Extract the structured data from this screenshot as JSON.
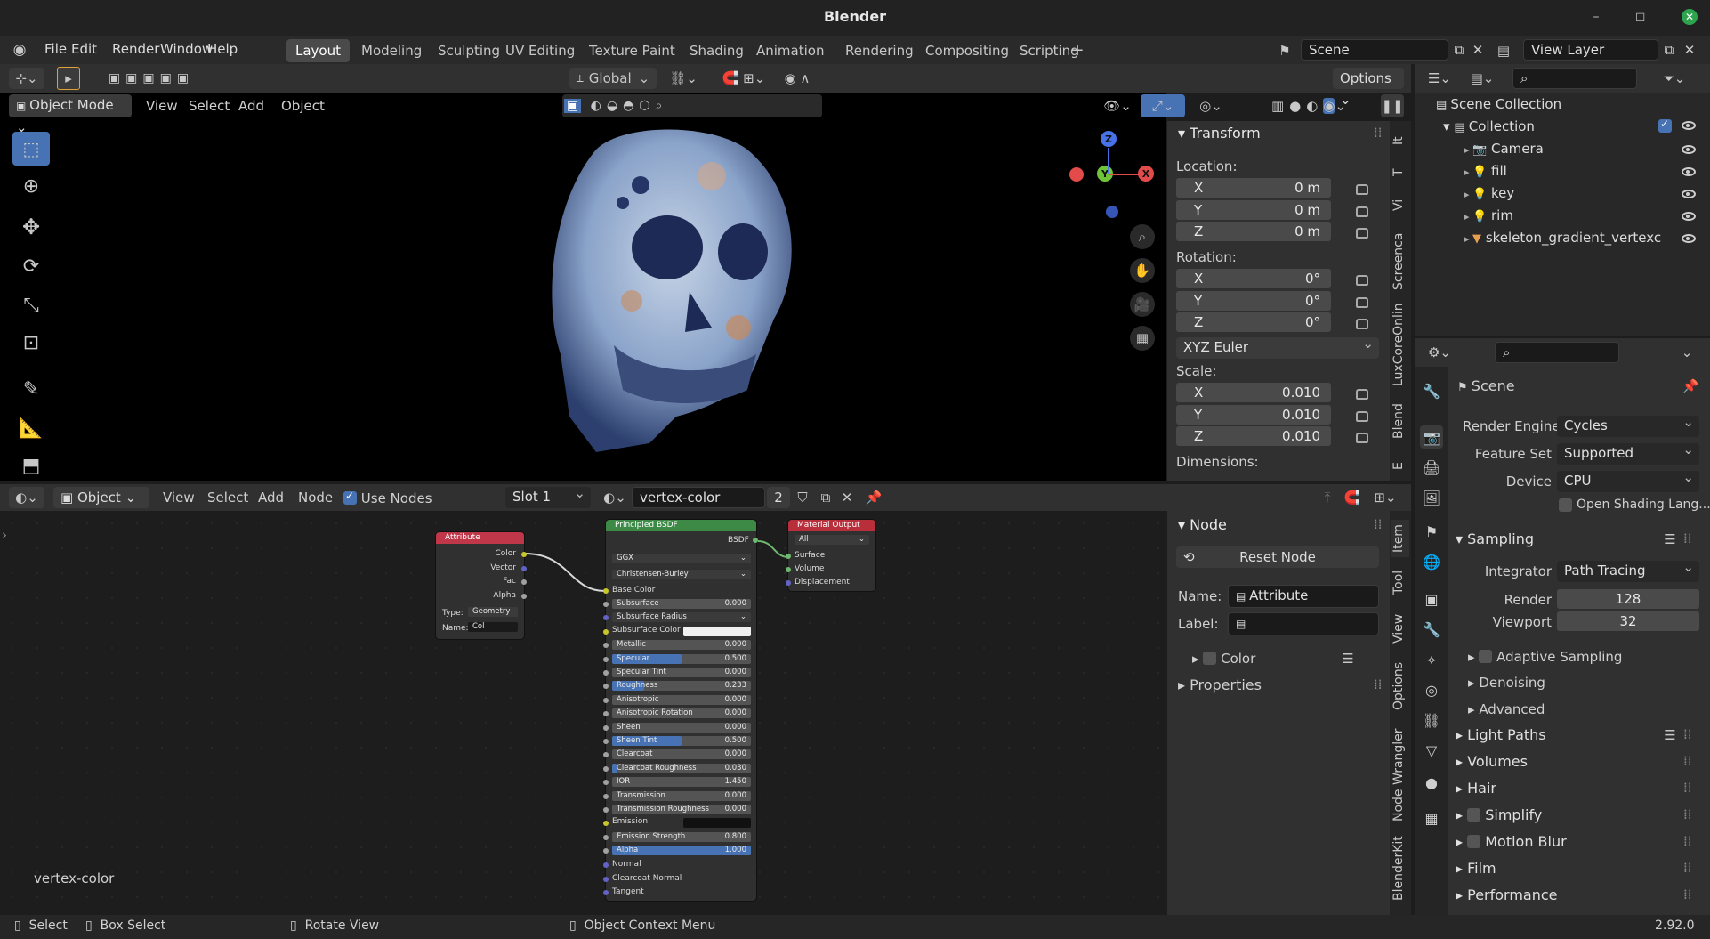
{
  "window": {
    "title": "Blender",
    "minimize": "–",
    "maximize": "◻",
    "close": "✕"
  },
  "menu": [
    "File",
    "Edit",
    "Render",
    "Window",
    "Help"
  ],
  "workspaces": [
    "Layout",
    "Modeling",
    "Sculpting",
    "UV Editing",
    "Texture Paint",
    "Shading",
    "Animation",
    "Rendering",
    "Compositing",
    "Scripting"
  ],
  "active_workspace": "Layout",
  "scene_name": "Scene",
  "view_layer": "View Layer",
  "viewport": {
    "mode": "Object Mode",
    "menus": [
      "View",
      "Select",
      "Add",
      "Object"
    ],
    "orientation": "Global",
    "options": "Options",
    "gizmo_axes": [
      "X",
      "Y",
      "Z"
    ]
  },
  "transform": {
    "title": "Transform",
    "location_label": "Location:",
    "rotation_label": "Rotation:",
    "scale_label": "Scale:",
    "dimensions_label": "Dimensions:",
    "location": [
      {
        "axis": "X",
        "value": "0 m"
      },
      {
        "axis": "Y",
        "value": "0 m"
      },
      {
        "axis": "Z",
        "value": "0 m"
      }
    ],
    "rotation": [
      {
        "axis": "X",
        "value": "0°"
      },
      {
        "axis": "Y",
        "value": "0°"
      },
      {
        "axis": "Z",
        "value": "0°"
      }
    ],
    "rotation_mode": "XYZ Euler",
    "scale": [
      {
        "axis": "X",
        "value": "0.010"
      },
      {
        "axis": "Y",
        "value": "0.010"
      },
      {
        "axis": "Z",
        "value": "0.010"
      }
    ]
  },
  "viewport_side_tabs": [
    "It",
    "T",
    "Vi",
    "Screenca",
    "LuxCoreOnlin",
    "Blend",
    "E"
  ],
  "outliner": {
    "root": "Scene Collection",
    "collection": "Collection",
    "items": [
      "Camera",
      "fill",
      "key",
      "rim",
      "skeleton_gradient_vertexc"
    ]
  },
  "properties": {
    "context": "Scene",
    "render_engine_label": "Render Engine",
    "render_engine": "Cycles",
    "feature_set_label": "Feature Set",
    "feature_set": "Supported",
    "device_label": "Device",
    "device": "CPU",
    "osl_label": "Open Shading Lang...",
    "sampling": "Sampling",
    "integrator_label": "Integrator",
    "integrator": "Path Tracing",
    "render_label": "Render",
    "render_samples": "128",
    "viewport_label": "Viewport",
    "viewport_samples": "32",
    "adaptive_sampling": "Adaptive Sampling",
    "denoising": "Denoising",
    "advanced": "Advanced",
    "sections": [
      "Light Paths",
      "Volumes",
      "Hair",
      "Simplify",
      "Motion Blur",
      "Film",
      "Performance"
    ]
  },
  "node_editor": {
    "object_dd": "Object",
    "menus": [
      "View",
      "Select",
      "Add",
      "Node"
    ],
    "use_nodes": "Use Nodes",
    "slot": "Slot 1",
    "material": "vertex-color",
    "users": "2",
    "tree_label": "vertex-color",
    "side_tabs": [
      "Item",
      "Tool",
      "View",
      "Options",
      "Node Wrangler",
      "BlenderKit"
    ]
  },
  "node_panel": {
    "title": "Node",
    "reset": "Reset Node",
    "name_label": "Name:",
    "name": "Attribute",
    "label_label": "Label:",
    "label": "",
    "color": "Color",
    "properties": "Properties"
  },
  "attribute_node": {
    "title": "Attribute",
    "outputs": [
      "Color",
      "Vector",
      "Fac",
      "Alpha"
    ],
    "type_label": "Type:",
    "type": "Geometry",
    "name_label": "Name:",
    "name": "Col"
  },
  "bsdf_node": {
    "title": "Principled BSDF",
    "output": "BSDF",
    "distribution": "GGX",
    "subsurface_method": "Christensen-Burley",
    "base_color": "Base Color",
    "rows": [
      {
        "label": "Subsurface",
        "value": "0.000",
        "fill": 0
      },
      {
        "label": "Subsurface Radius",
        "value": "",
        "fill": 0
      },
      {
        "label": "Subsurface Color",
        "value": "",
        "fill": 0
      },
      {
        "label": "Metallic",
        "value": "0.000",
        "fill": 0
      },
      {
        "label": "Specular",
        "value": "0.500",
        "fill": 0.5
      },
      {
        "label": "Specular Tint",
        "value": "0.000",
        "fill": 0
      },
      {
        "label": "Roughness",
        "value": "0.233",
        "fill": 0.233
      },
      {
        "label": "Anisotropic",
        "value": "0.000",
        "fill": 0
      },
      {
        "label": "Anisotropic Rotation",
        "value": "0.000",
        "fill": 0
      },
      {
        "label": "Sheen",
        "value": "0.000",
        "fill": 0
      },
      {
        "label": "Sheen Tint",
        "value": "0.500",
        "fill": 0.5
      },
      {
        "label": "Clearcoat",
        "value": "0.000",
        "fill": 0
      },
      {
        "label": "Clearcoat Roughness",
        "value": "0.030",
        "fill": 0.03
      },
      {
        "label": "IOR",
        "value": "1.450",
        "fill": 0
      },
      {
        "label": "Transmission",
        "value": "0.000",
        "fill": 0
      },
      {
        "label": "Transmission Roughness",
        "value": "0.000",
        "fill": 0
      },
      {
        "label": "Emission",
        "value": "",
        "fill": 0
      },
      {
        "label": "Emission Strength",
        "value": "0.800",
        "fill": 0
      },
      {
        "label": "Alpha",
        "value": "1.000",
        "fill": 1
      }
    ],
    "inputs_tail": [
      "Normal",
      "Clearcoat Normal",
      "Tangent"
    ]
  },
  "output_node": {
    "title": "Material Output",
    "target": "All",
    "inputs": [
      "Surface",
      "Volume",
      "Displacement"
    ]
  },
  "statusbar": {
    "select": "Select",
    "box_select": "Box Select",
    "rotate": "Rotate View",
    "context": "Object Context Menu",
    "version": "2.92.0"
  },
  "colors": {
    "accent": "#4772b3",
    "header_bg": "#303030",
    "attr_header": "#c0374a",
    "bsdf_header": "#3c8a46",
    "output_header": "#b82f3b"
  }
}
